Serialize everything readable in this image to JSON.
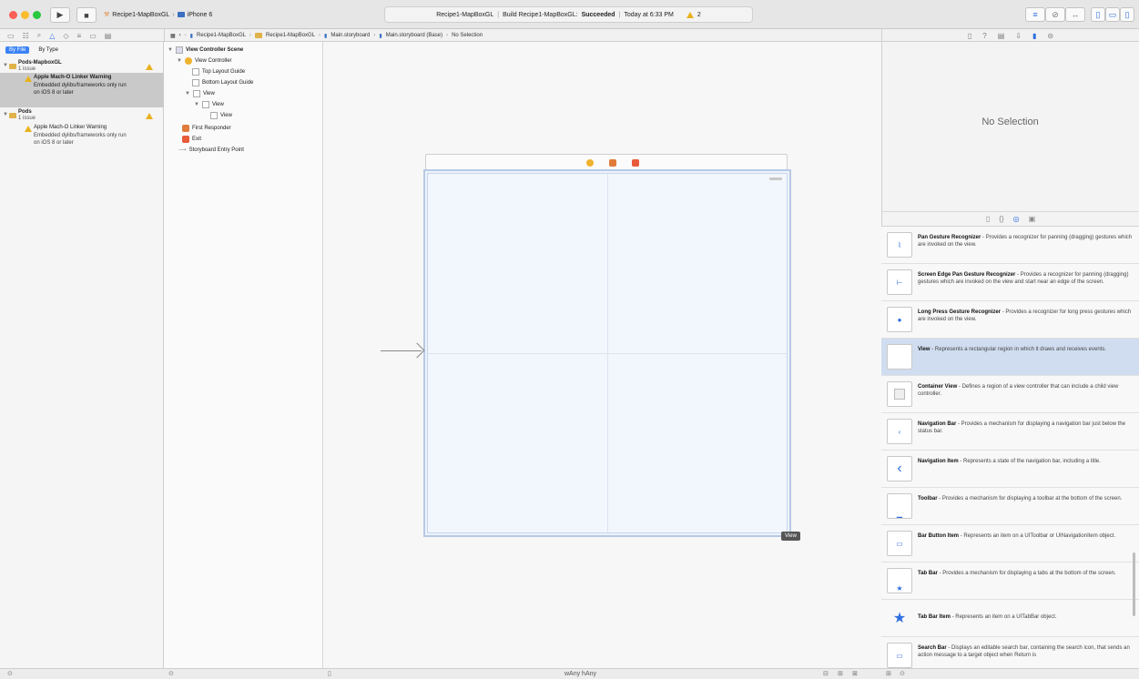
{
  "toolbar": {
    "scheme": "Recipe1-MapBoxGL",
    "device": "iPhone 6",
    "activity_project": "Recipe1-MapBoxGL",
    "activity_prefix": "Build Recipe1-MapBoxGL:",
    "activity_status": "Succeeded",
    "activity_time": "Today at 6:33 PM",
    "warning_count": "2"
  },
  "breadcrumb": [
    "Recipe1-MapBoxGL",
    "Recipe1-MapBoxGL",
    "Main.storyboard",
    "Main.storyboard (Base)",
    "No Selection"
  ],
  "navigator": {
    "tab_file": "By File",
    "tab_type": "By Type",
    "groups": [
      {
        "name": "Pods-MapboxGL",
        "count": "1 issue",
        "title": "Apple Mach-O Linker Warning",
        "line1": "Embedded dylibs/frameworks only run",
        "line2": "on iOS 8 or later"
      },
      {
        "name": "Pods",
        "count": "1 issue",
        "title": "Apple Mach-O Linker Warning",
        "line1": "Embedded dylibs/frameworks only run",
        "line2": "on iOS 8 or later"
      }
    ]
  },
  "outline": {
    "scene": "View Controller Scene",
    "vc": "View Controller",
    "top": "Top Layout Guide",
    "bottom": "Bottom Layout Guide",
    "view1": "View",
    "view2": "View",
    "view3": "View",
    "responder": "First Responder",
    "exit": "Exit",
    "entry": "Storyboard Entry Point"
  },
  "canvas": {
    "tooltip": "View",
    "size_class": "wAny hAny"
  },
  "inspector": {
    "no_selection": "No Selection"
  },
  "library": [
    {
      "name": "Pan Gesture Recognizer",
      "desc": " - Provides a recognizer for panning (dragging) gestures which are invoked on the view.",
      "icon": "pan-gesture-icon"
    },
    {
      "name": "Screen Edge Pan Gesture Recognizer",
      "desc": " - Provides a recognizer for panning (dragging) gestures which are invoked on the view and start near an edge of the screen.",
      "icon": "edge-pan-icon"
    },
    {
      "name": "Long Press Gesture Recognizer",
      "desc": " - Provides a recognizer for long press gestures which are invoked on the view.",
      "icon": "long-press-icon"
    },
    {
      "name": "View",
      "desc": " - Represents a rectangular region in which it draws and receives events.",
      "icon": "view-icon"
    },
    {
      "name": "Container View",
      "desc": " - Defines a region of a view controller that can include a child view controller.",
      "icon": "container-view-icon"
    },
    {
      "name": "Navigation Bar",
      "desc": " - Provides a mechanism for displaying a navigation bar just below the status bar.",
      "icon": "navigation-bar-icon"
    },
    {
      "name": "Navigation Item",
      "desc": " - Represents a state of the navigation bar, including a title.",
      "icon": "navigation-item-icon"
    },
    {
      "name": "Toolbar",
      "desc": " - Provides a mechanism for displaying a toolbar at the bottom of the screen.",
      "icon": "toolbar-icon"
    },
    {
      "name": "Bar Button Item",
      "desc": " - Represents an item on a UIToolbar or UINavigationItem object.",
      "icon": "bar-button-item-icon"
    },
    {
      "name": "Tab Bar",
      "desc": " - Provides a mechanism for displaying a tabs at the bottom of the screen.",
      "icon": "tab-bar-icon"
    },
    {
      "name": "Tab Bar Item",
      "desc": " - Represents an item on a UITabBar object.",
      "icon": "tab-bar-item-icon"
    },
    {
      "name": "Search Bar",
      "desc": " - Displays an editable search bar, containing the search icon, that sends an action message to a target object when Return is",
      "icon": "search-bar-icon"
    }
  ],
  "colors": {
    "accent": "#3b82f6",
    "warning": "#e8b21e"
  }
}
